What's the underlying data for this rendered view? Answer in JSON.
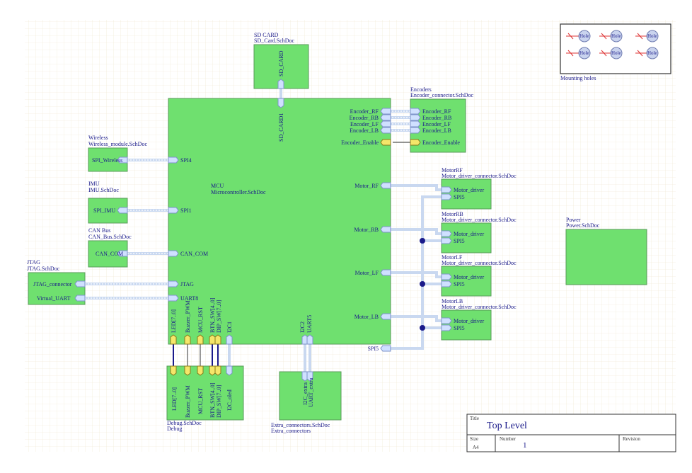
{
  "blocks": {
    "mcu": {
      "designator": "MCU",
      "file": "Microcontroller.SchDoc"
    },
    "sdcard": {
      "designator": "SD CARD",
      "file": "SD_Card.SchDoc",
      "port": "SD_CARD",
      "mcu_port": "SD_CARD1"
    },
    "encoders": {
      "designator": "Encoders",
      "file": "Encoder_connector.SchDoc"
    },
    "wireless": {
      "designator": "Wireless",
      "file": "Wireless_module.SchDoc",
      "port": "SPI_Wireless"
    },
    "imu": {
      "designator": "IMU",
      "file": "IMU.SchDoc",
      "port": "SPI_IMU"
    },
    "canbus": {
      "designator": "CAN Bus",
      "file": "CAN_Bus.SchDoc",
      "port": "CAN_COM"
    },
    "jtag": {
      "designator": "JTAG",
      "file": "JTAG.SchDoc",
      "ports": [
        "JTAG_connector",
        "Virtual_UART"
      ]
    },
    "motorrf": {
      "designator": "MotorRF",
      "file": "Motor_driver_connector.SchDoc"
    },
    "motorrb": {
      "designator": "MotorRB",
      "file": "Motor_driver_connector.SchDoc"
    },
    "motorlf": {
      "designator": "MotorLF",
      "file": "Motor_driver_connector.SchDoc"
    },
    "motorlb": {
      "designator": "MotorLB",
      "file": "Motor_driver_connector.SchDoc"
    },
    "power": {
      "designator": "Power",
      "file": "Power.SchDoc"
    },
    "debug": {
      "file": "Debug.SchDoc",
      "designator": "Debug"
    },
    "extra": {
      "file": "Extra_connectors.SchDoc",
      "designator": "Extra_connectors"
    }
  },
  "mcu_ports_left": [
    "SPI4",
    "SPI1",
    "CAN_COM",
    "JTAG",
    "UART8"
  ],
  "mcu_ports_right": [
    "Encoder_RF",
    "Encoder_RB",
    "Encoder_LF",
    "Encoder_LB",
    "Encoder_Enable",
    "Motor_RF",
    "Motor_RB",
    "Motor_LF",
    "Motor_LB",
    "SPI5"
  ],
  "mcu_ports_bottom": [
    "LED[7..0]",
    "Buzzer_PWM",
    "MCU_RST",
    "BTN_SW[4..0]",
    "DIP_SW[7..0]",
    "I2C1",
    "I2C2",
    "UART5"
  ],
  "encoder_ports": [
    "Encoder_RF",
    "Encoder_RB",
    "Encoder_LF",
    "Encoder_LB",
    "Encoder_Enable"
  ],
  "motor_ports": [
    "Motor_driver",
    "SPI5"
  ],
  "debug_ports": [
    "LED[7..0]",
    "Buzzer_PWM",
    "MCU_RST",
    "BTN_SW[4..0]",
    "DIP_SW[7..0]",
    "I2C_oled"
  ],
  "extra_ports": [
    "I2C_extra",
    "UART_extra"
  ],
  "mounting": {
    "label": "Mounting holes",
    "hole_text": "Hole"
  },
  "title_block": {
    "title_label": "Title",
    "title": "Top Level",
    "size_label": "Size",
    "size": "A4",
    "number_label": "Number",
    "number": "1",
    "revision_label": "Revision"
  }
}
